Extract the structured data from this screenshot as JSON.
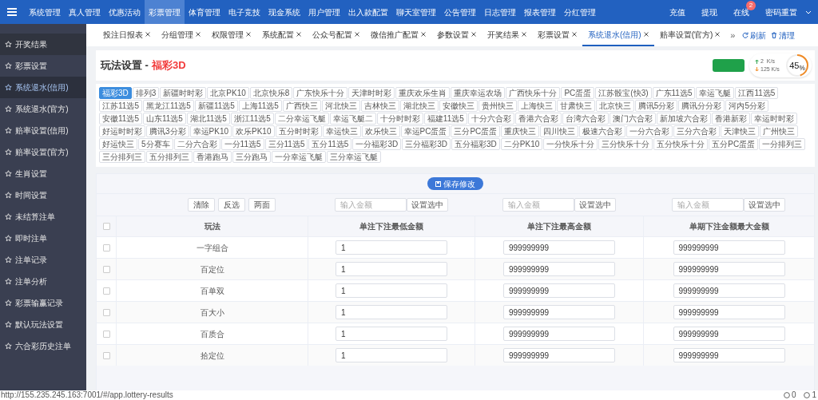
{
  "top_nav": {
    "menu": [
      {
        "label": "系统管理",
        "selected": false
      },
      {
        "label": "真人管理",
        "selected": false
      },
      {
        "label": "优惠活动",
        "selected": false
      },
      {
        "label": "彩票管理",
        "selected": true
      },
      {
        "label": "体育管理",
        "selected": false
      },
      {
        "label": "电子竞技",
        "selected": false
      },
      {
        "label": "现金系统",
        "selected": false
      },
      {
        "label": "用户管理",
        "selected": false
      },
      {
        "label": "出入款配置",
        "selected": false
      },
      {
        "label": "聊天室管理",
        "selected": false
      },
      {
        "label": "公告管理",
        "selected": false
      },
      {
        "label": "日志管理",
        "selected": false
      },
      {
        "label": "报表管理",
        "selected": false
      },
      {
        "label": "分红管理",
        "selected": false
      }
    ],
    "right": [
      {
        "label": "充值"
      },
      {
        "label": "提现"
      },
      {
        "label": "在线",
        "badge": "2"
      },
      {
        "label": "密码重置"
      }
    ]
  },
  "sidebar": {
    "items": [
      {
        "label": "开奖结果",
        "selected": false
      },
      {
        "label": "彩票设置",
        "selected": false
      },
      {
        "label": "系统退水(信用)",
        "selected": true
      },
      {
        "label": "系统退水(官方)",
        "selected": false
      },
      {
        "label": "赔率设置(信用)",
        "selected": false
      },
      {
        "label": "赔率设置(官方)",
        "selected": false
      },
      {
        "label": "生肖设置",
        "selected": false
      },
      {
        "label": "时间设置",
        "selected": false
      },
      {
        "label": "未结算注单",
        "selected": false
      },
      {
        "label": "即时注单",
        "selected": false
      },
      {
        "label": "注单记录",
        "selected": false
      },
      {
        "label": "注单分析",
        "selected": false
      },
      {
        "label": "彩票输赢记录",
        "selected": false
      },
      {
        "label": "默认玩法设置",
        "selected": false
      },
      {
        "label": "六合彩历史注单",
        "selected": false
      }
    ]
  },
  "tabs": {
    "items": [
      {
        "label": "投注日报表",
        "selected": false
      },
      {
        "label": "分组管理",
        "selected": false
      },
      {
        "label": "权限管理",
        "selected": false
      },
      {
        "label": "系统配置",
        "selected": false
      },
      {
        "label": "公众号配置",
        "selected": false
      },
      {
        "label": "微信推广配置",
        "selected": false
      },
      {
        "label": "参数设置",
        "selected": false
      },
      {
        "label": "开奖结果",
        "selected": false
      },
      {
        "label": "彩票设置",
        "selected": false
      },
      {
        "label": "系统退水(信用)",
        "selected": true
      },
      {
        "label": "赔率设置(官方)",
        "selected": false
      }
    ],
    "more": "»",
    "actions": [
      {
        "label": "刷新",
        "kind": "refresh"
      },
      {
        "label": "清理",
        "kind": "clear"
      }
    ]
  },
  "network_widget": {
    "upload": "2  K/s",
    "download": "125 K/s",
    "percent": "45$_{%}$",
    "level": 0.45
  },
  "page": {
    "title": "玩法设置 -",
    "game": "福彩3D"
  },
  "lotteries": [
    {
      "label": "福彩3D",
      "selected": true
    },
    {
      "label": "排列3",
      "selected": false
    },
    {
      "label": "新疆时时彩",
      "selected": false
    },
    {
      "label": "北京PK10",
      "selected": false
    },
    {
      "label": "北京快乐8",
      "selected": false
    },
    {
      "label": "广东快乐十分",
      "selected": false
    },
    {
      "label": "天津时时彩",
      "selected": false
    },
    {
      "label": "重庆欢乐生肖",
      "selected": false
    },
    {
      "label": "重庆幸运农场",
      "selected": false
    },
    {
      "label": "广西快乐十分",
      "selected": false
    },
    {
      "label": "PC蛋蛋",
      "selected": false
    },
    {
      "label": "江苏骰宝(快3)",
      "selected": false
    },
    {
      "label": "广东11选5",
      "selected": false
    },
    {
      "label": "幸运飞艇",
      "selected": false
    },
    {
      "label": "江西11选5",
      "selected": false
    },
    {
      "label": "江苏11选5",
      "selected": false
    },
    {
      "label": "黑龙江11选5",
      "selected": false
    },
    {
      "label": "新疆11选5",
      "selected": false
    },
    {
      "label": "上海11选5",
      "selected": false
    },
    {
      "label": "广西快三",
      "selected": false
    },
    {
      "label": "河北快三",
      "selected": false
    },
    {
      "label": "吉林快三",
      "selected": false
    },
    {
      "label": "湖北快三",
      "selected": false
    },
    {
      "label": "安徽快三",
      "selected": false
    },
    {
      "label": "贵州快三",
      "selected": false
    },
    {
      "label": "上海快三",
      "selected": false
    },
    {
      "label": "甘肃快三",
      "selected": false
    },
    {
      "label": "北京快三",
      "selected": false
    },
    {
      "label": "腾讯5分彩",
      "selected": false
    },
    {
      "label": "腾讯分分彩",
      "selected": false
    },
    {
      "label": "河内5分彩",
      "selected": false
    },
    {
      "label": "安徽11选5",
      "selected": false
    },
    {
      "label": "山东11选5",
      "selected": false
    },
    {
      "label": "湖北11选5",
      "selected": false
    },
    {
      "label": "浙江11选5",
      "selected": false
    },
    {
      "label": "二分幸运飞艇",
      "selected": false
    },
    {
      "label": "幸运飞艇二",
      "selected": false
    },
    {
      "label": "十分时时彩",
      "selected": false
    },
    {
      "label": "福建11选5",
      "selected": false
    },
    {
      "label": "十分六合彩",
      "selected": false
    },
    {
      "label": "香港六合彩",
      "selected": false
    },
    {
      "label": "台湾六合彩",
      "selected": false
    },
    {
      "label": "澳门六合彩",
      "selected": false
    },
    {
      "label": "新加坡六合彩",
      "selected": false
    },
    {
      "label": "香港新彩",
      "selected": false
    },
    {
      "label": "幸运时时彩",
      "selected": false
    },
    {
      "label": "好运时时彩",
      "selected": false
    },
    {
      "label": "腾讯3分彩",
      "selected": false
    },
    {
      "label": "幸运PK10",
      "selected": false
    },
    {
      "label": "欢乐PK10",
      "selected": false
    },
    {
      "label": "五分时时彩",
      "selected": false
    },
    {
      "label": "幸运快三",
      "selected": false
    },
    {
      "label": "欢乐快三",
      "selected": false
    },
    {
      "label": "幸运PC蛋蛋",
      "selected": false
    },
    {
      "label": "三分PC蛋蛋",
      "selected": false
    },
    {
      "label": "重庆快三",
      "selected": false
    },
    {
      "label": "四川快三",
      "selected": false
    },
    {
      "label": "极速六合彩",
      "selected": false
    },
    {
      "label": "一分六合彩",
      "selected": false
    },
    {
      "label": "三分六合彩",
      "selected": false
    },
    {
      "label": "天津快三",
      "selected": false
    },
    {
      "label": "广州快三",
      "selected": false
    },
    {
      "label": "好运快三",
      "selected": false
    },
    {
      "label": "5分赛车",
      "selected": false
    },
    {
      "label": "二分六合彩",
      "selected": false
    },
    {
      "label": "一分11选5",
      "selected": false
    },
    {
      "label": "三分11选5",
      "selected": false
    },
    {
      "label": "五分11选5",
      "selected": false
    },
    {
      "label": "一分福彩3D",
      "selected": false
    },
    {
      "label": "三分福彩3D",
      "selected": false
    },
    {
      "label": "五分福彩3D",
      "selected": false
    },
    {
      "label": "二分PK10",
      "selected": false
    },
    {
      "label": "一分快乐十分",
      "selected": false
    },
    {
      "label": "三分快乐十分",
      "selected": false
    },
    {
      "label": "五分快乐十分",
      "selected": false
    },
    {
      "label": "五分PC蛋蛋",
      "selected": false
    },
    {
      "label": "一分排列三",
      "selected": false
    },
    {
      "label": "三分排列三",
      "selected": false
    },
    {
      "label": "五分排列三",
      "selected": false
    },
    {
      "label": "香港跑马",
      "selected": false
    },
    {
      "label": "三分跑马",
      "selected": false
    },
    {
      "label": "一分幸运飞艇",
      "selected": false
    },
    {
      "label": "三分幸运飞艇",
      "selected": false
    }
  ],
  "save_button": "保存修改",
  "bulk_buttons": [
    "清除",
    "反选",
    "两面"
  ],
  "bulk_inputs": [
    {
      "placeholder": "输入金额",
      "button": "设置选中"
    },
    {
      "placeholder": "输入金额",
      "button": "设置选中"
    },
    {
      "placeholder": "输入金额",
      "button": "设置选中"
    }
  ],
  "table": {
    "all_checked": false,
    "columns": [
      "玩法",
      "单注下注最低金额",
      "单注下注最高金额",
      "单期下注金额最大金额"
    ],
    "rows": [
      {
        "name": "一字组合",
        "checked": false,
        "min": "1",
        "max": "999999999",
        "period_max": "999999999"
      },
      {
        "name": "百定位",
        "checked": false,
        "min": "1",
        "max": "999999999",
        "period_max": "999999999"
      },
      {
        "name": "百单双",
        "checked": false,
        "min": "1",
        "max": "999999999",
        "period_max": "999999999"
      },
      {
        "name": "百大小",
        "checked": false,
        "min": "1",
        "max": "999999999",
        "period_max": "999999999"
      },
      {
        "name": "百质合",
        "checked": false,
        "min": "1",
        "max": "999999999",
        "period_max": "999999999"
      },
      {
        "name": "拾定位",
        "checked": false,
        "min": "1",
        "max": "999999999",
        "period_max": "999999999"
      }
    ]
  },
  "status_bar": {
    "url": "http://155.235.245.163:7001/#/app.lottery-results",
    "counts": [
      "0",
      "1"
    ]
  }
}
